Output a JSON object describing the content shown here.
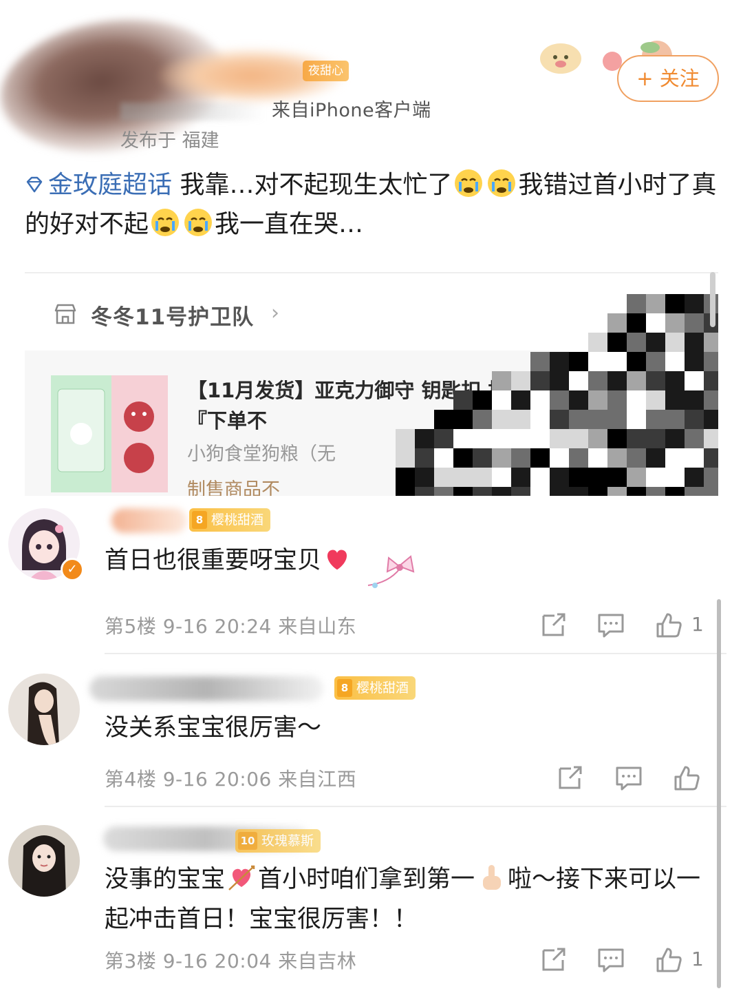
{
  "post": {
    "fan_badge": "夜甜心",
    "client": "来自iPhone客户端",
    "location": "发布于 福建",
    "follow_label": "+ 关注",
    "topic": "金玫庭超话",
    "text_part1": " 我靠…对不起现生太忙了",
    "text_part2": "我错过首小时了真的好对不起",
    "text_part3": "我一直在哭…"
  },
  "card": {
    "shop_name": "冬冬11号护卫队",
    "chevron": "›",
    "product_title": "【11月发货】亚克力御守 钥匙扣 提前确认收货』『下单不",
    "product_sub": "小狗食堂狗粮（无",
    "product_note": "制售商品不"
  },
  "comments": [
    {
      "badge_level": "8",
      "badge_name": "樱桃甜酒",
      "text": "首日也很重要呀宝贝",
      "floor": "第5楼",
      "time": "9-16 20:24",
      "from": "来自山东",
      "likes": "1"
    },
    {
      "badge_level": "8",
      "badge_name": "樱桃甜酒",
      "text": "没关系宝宝很厉害～",
      "floor": "第4楼",
      "time": "9-16 20:06",
      "from": "来自江西",
      "likes": ""
    },
    {
      "badge_level": "10",
      "badge_name": "玫瑰慕斯",
      "text_part1": "没事的宝宝",
      "text_part2": "首小时咱们拿到第一",
      "text_part3": "啦～接下来可以一起冲击首日！宝宝很厉害！！",
      "floor": "第3楼",
      "time": "9-16 20:04",
      "from": "来自吉林",
      "likes": "1"
    }
  ],
  "icons": {
    "topic": "diamond-icon",
    "shop": "shop-icon",
    "repost": "repost-icon",
    "comment": "comment-icon",
    "like": "like-icon"
  },
  "colors": {
    "accent": "#f08a30",
    "topic_blue": "#3b6eb5",
    "meta_gray": "#9a9a9a"
  }
}
